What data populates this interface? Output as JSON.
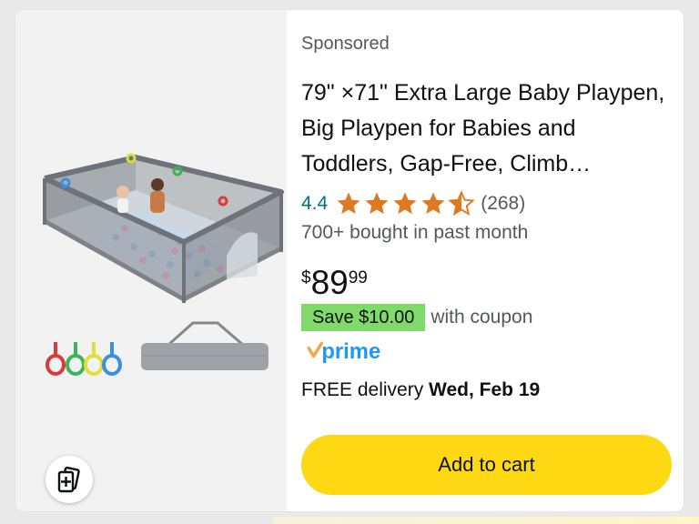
{
  "listing": {
    "sponsored_label": "Sponsored",
    "title": "79\" ×71\" Extra Large Baby Playpen, Big Playpen for Babies and Toddlers, Gap-Free, Climb…",
    "rating": {
      "value": "4.4",
      "count": "(268)",
      "stars_out_of_5": 4.5
    },
    "bought_text": "700+ bought in past month",
    "price": {
      "symbol": "$",
      "whole": "89",
      "fraction": "99"
    },
    "coupon": {
      "badge": "Save $10.00",
      "text": "with coupon"
    },
    "prime_label": "prime",
    "delivery": {
      "prefix": "FREE delivery",
      "date": "Wed, Feb 19"
    },
    "add_to_cart_label": "Add to cart"
  },
  "icons": {
    "star": "star-icon",
    "prime": "prime-logo",
    "view_in_room": "view-in-room-icon"
  },
  "colors": {
    "star": "#de7921",
    "rating_link": "#007185",
    "coupon_badge": "#7fda69",
    "add_to_cart": "#ffd814",
    "prime_blue": "#1a98ff",
    "prime_orange": "#f3a847"
  }
}
